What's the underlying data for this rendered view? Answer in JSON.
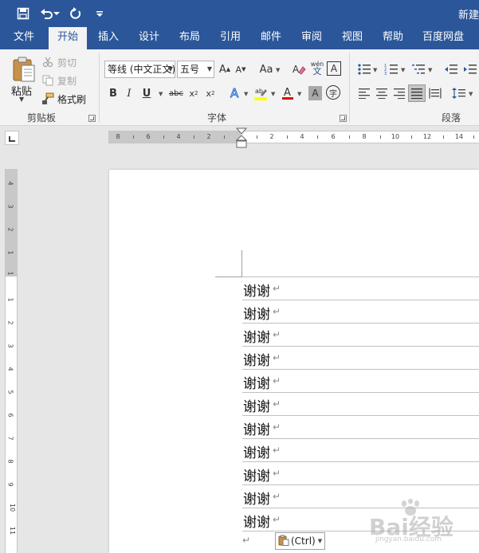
{
  "title_bar": {
    "doc_title": "新建",
    "quick_access": [
      "save-icon",
      "undo-icon",
      "redo-icon",
      "customize-icon"
    ]
  },
  "tabs": [
    {
      "label": "文件"
    },
    {
      "label": "开始",
      "active": true
    },
    {
      "label": "插入"
    },
    {
      "label": "设计"
    },
    {
      "label": "布局"
    },
    {
      "label": "引用"
    },
    {
      "label": "邮件"
    },
    {
      "label": "审阅"
    },
    {
      "label": "视图"
    },
    {
      "label": "帮助"
    },
    {
      "label": "百度网盘"
    }
  ],
  "clipboard": {
    "paste_label": "粘贴",
    "cut_label": "剪切",
    "copy_label": "复制",
    "format_painter_label": "格式刷",
    "group_label": "剪贴板"
  },
  "font": {
    "font_name": "等线 (中文正文)",
    "font_size": "五号",
    "phonetic_top": "wén",
    "phonetic_bottom": "文",
    "strikethrough_label": "abc",
    "group_label": "字体",
    "highlight_color": "#ffff00",
    "font_color": "#e00000"
  },
  "paragraph": {
    "group_label": "段落"
  },
  "ruler": {
    "h_ticks": [
      "8",
      "6",
      "4",
      "2",
      "2",
      "4",
      "6",
      "8",
      "10",
      "12",
      "14"
    ],
    "v_ticks": [
      "4",
      "3",
      "2",
      "1",
      "1",
      "1",
      "2",
      "3",
      "4",
      "5",
      "6",
      "7",
      "8",
      "9",
      "10",
      "11"
    ]
  },
  "document": {
    "lines": [
      "谢谢",
      "谢谢",
      "谢谢",
      "谢谢",
      "谢谢",
      "谢谢",
      "谢谢",
      "谢谢",
      "谢谢",
      "谢谢",
      "谢谢"
    ],
    "paragraph_mark": "↵"
  },
  "paste_options": {
    "label": "(Ctrl)"
  },
  "watermark": {
    "text": "Bai经验",
    "sub": "jingyan.baidu.com"
  },
  "colors": {
    "title_bar": "#2b579a",
    "ribbon": "#f3f3f3",
    "canvas": "#e6e6e6"
  }
}
